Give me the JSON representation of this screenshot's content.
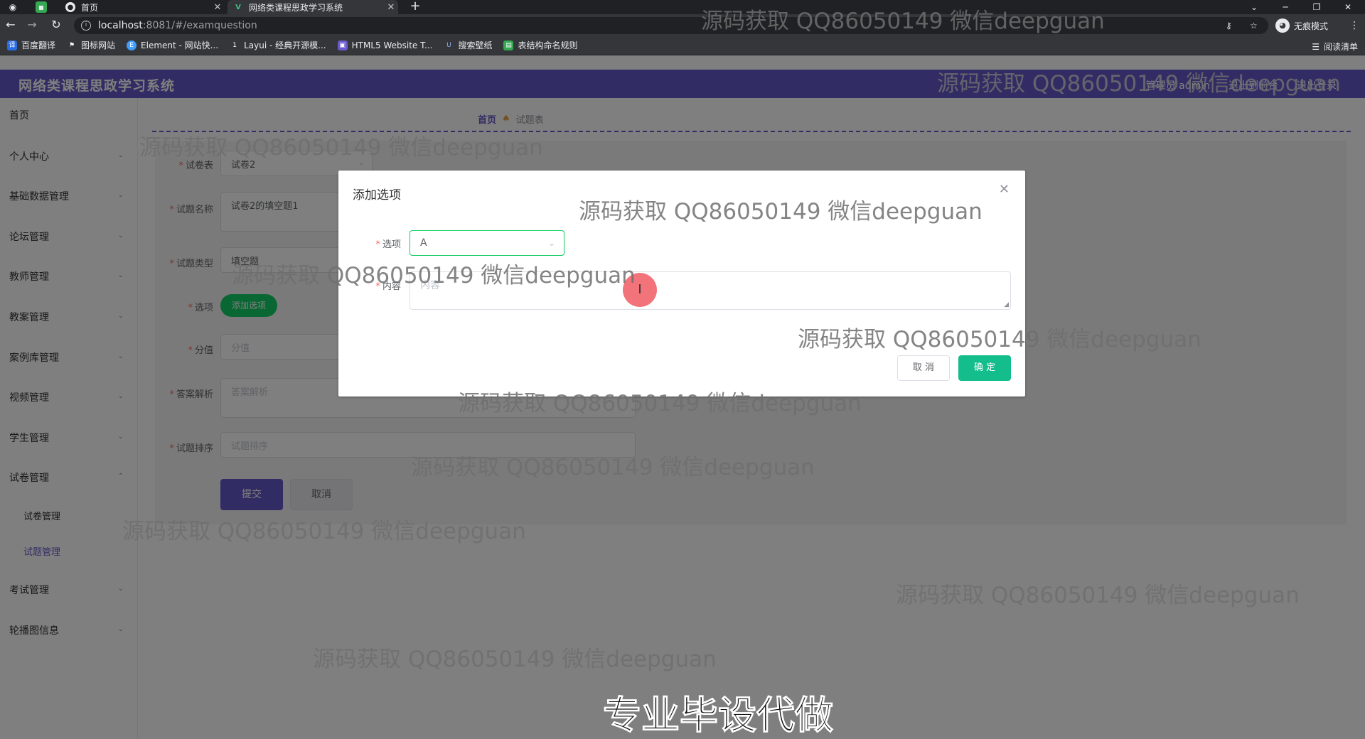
{
  "browser": {
    "tabs": [
      {
        "title": "首页"
      },
      {
        "title": "网络类课程思政学习系统"
      }
    ],
    "url_host": "localhost",
    "url_path": ":8081/#/examquestion",
    "incognito_label": "无痕模式",
    "bookmarks": [
      {
        "label": "百度翻译"
      },
      {
        "label": "图标网站"
      },
      {
        "label": "Element - 网站快..."
      },
      {
        "label": "Layui - 经典开源模..."
      },
      {
        "label": "HTML5 Website T..."
      },
      {
        "label": "搜索壁纸"
      },
      {
        "label": "表结构命名规则"
      }
    ],
    "reading_list": "阅读清单"
  },
  "app": {
    "title": "网络类课程思政学习系统",
    "header_right": [
      "管理员 admin",
      "退出到前台",
      "退出登录"
    ]
  },
  "sidebar": {
    "items": [
      {
        "label": "首页"
      },
      {
        "label": "个人中心"
      },
      {
        "label": "基础数据管理"
      },
      {
        "label": "论坛管理"
      },
      {
        "label": "教师管理"
      },
      {
        "label": "教案管理"
      },
      {
        "label": "案例库管理"
      },
      {
        "label": "视频管理"
      },
      {
        "label": "学生管理"
      },
      {
        "label": "试卷管理"
      },
      {
        "label": "试卷管理"
      },
      {
        "label": "试题管理"
      },
      {
        "label": "考试管理"
      },
      {
        "label": "轮播图信息"
      }
    ]
  },
  "breadcrumb": {
    "home": "首页",
    "current": "试题表"
  },
  "form": {
    "paper_label": "试卷表",
    "paper_value": "试卷2",
    "name_label": "试题名称",
    "name_value": "试卷2的填空题1",
    "type_label": "试题类型",
    "type_value": "填空题",
    "option_label": "选项",
    "add_option_btn": "添加选项",
    "score_label": "分值",
    "score_placeholder": "分值",
    "analysis_label": "答案解析",
    "analysis_placeholder": "答案解析",
    "sort_label": "试题排序",
    "sort_placeholder": "试题排序",
    "submit": "提交",
    "cancel": "取消"
  },
  "dialog": {
    "title": "添加选项",
    "option_label": "选项",
    "option_value": "A",
    "content_label": "内容",
    "content_placeholder": "内容",
    "cancel": "取 消",
    "confirm": "确 定"
  },
  "watermark": "源码获取 QQ86050149 微信deepguan",
  "caption": "专业毕设代做"
}
